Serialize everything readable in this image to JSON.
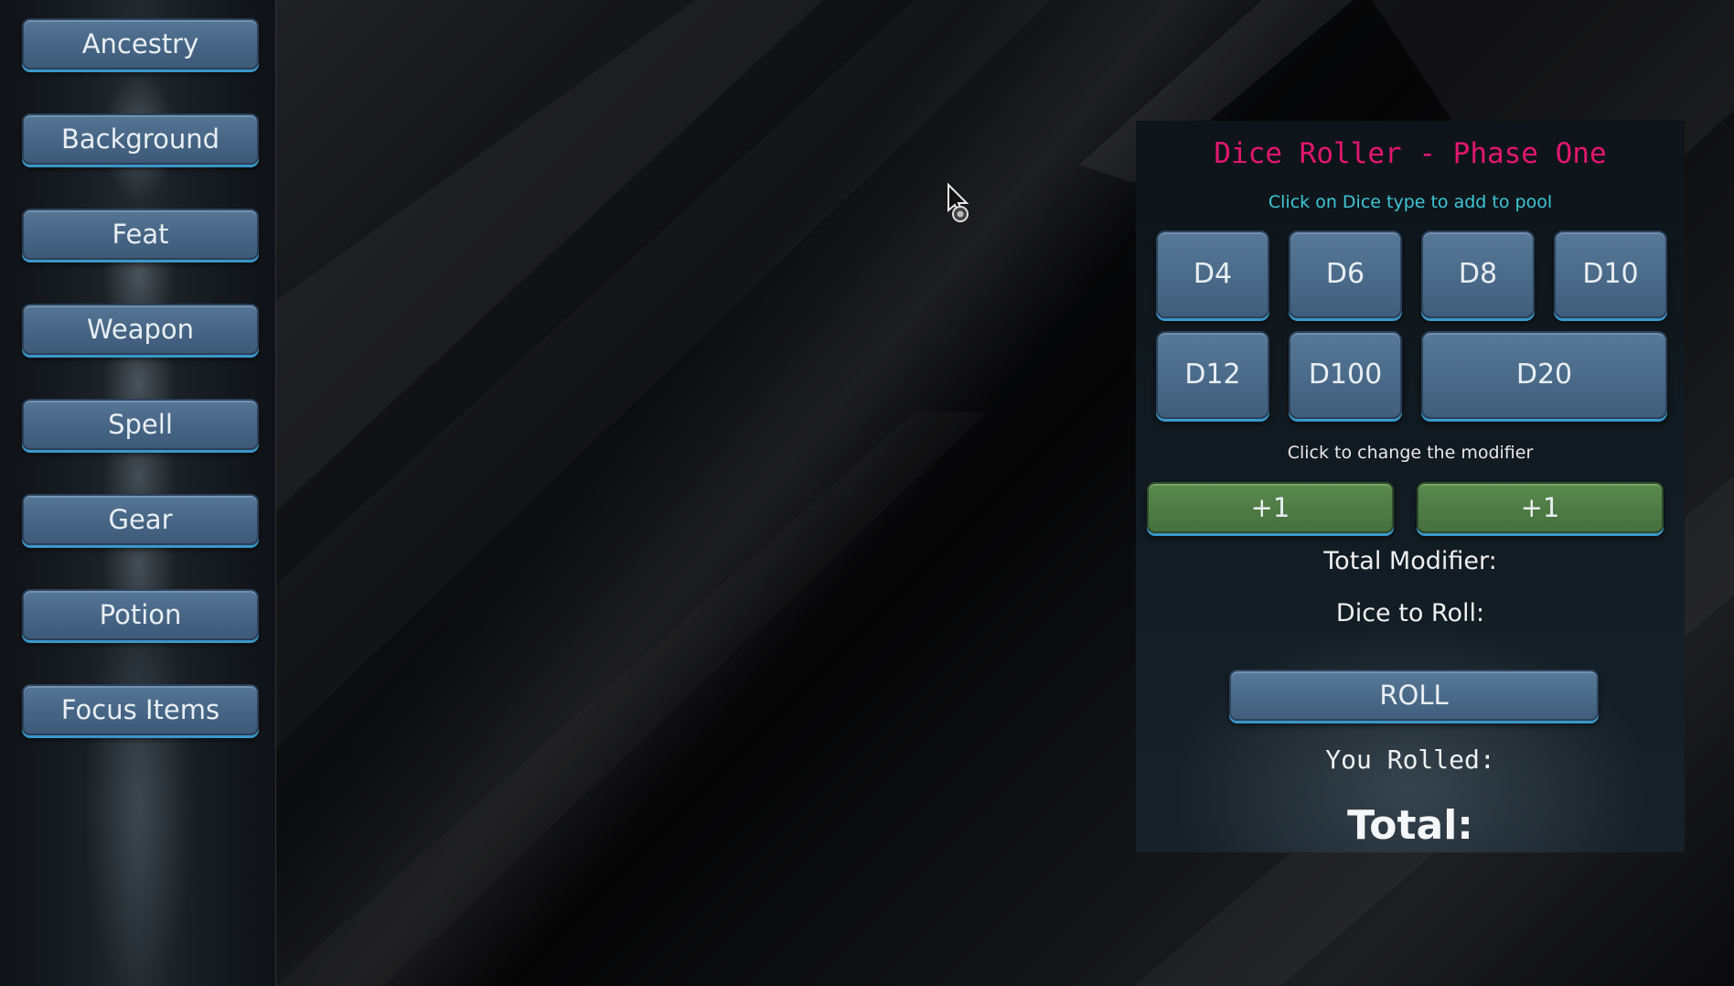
{
  "sidebar": {
    "items": [
      {
        "label": "Ancestry"
      },
      {
        "label": "Background"
      },
      {
        "label": "Feat"
      },
      {
        "label": "Weapon"
      },
      {
        "label": "Spell"
      },
      {
        "label": "Gear"
      },
      {
        "label": "Potion"
      },
      {
        "label": "Focus Items"
      }
    ]
  },
  "dice_roller": {
    "title": "Dice Roller - Phase One",
    "dice_hint": "Click on Dice type to add to pool",
    "dice": [
      {
        "label": "D4"
      },
      {
        "label": "D6"
      },
      {
        "label": "D8"
      },
      {
        "label": "D10"
      },
      {
        "label": "D12"
      },
      {
        "label": "D100"
      },
      {
        "label": "D20"
      }
    ],
    "modifier_hint": "Click to change the modifier",
    "modifiers": [
      {
        "label": "+1"
      },
      {
        "label": "+1"
      }
    ],
    "total_modifier_label": "Total Modifier:",
    "dice_to_roll_label": "Dice to Roll:",
    "roll_label": "ROLL",
    "you_rolled_label": "You Rolled:",
    "total_label": "Total:"
  },
  "colors": {
    "title_accent": "#e2176e",
    "hint_accent": "#3ec7d6",
    "button_blue": "#4a6a89",
    "button_green": "#4d7a44",
    "button_glow": "#3a97c9"
  },
  "icons": {
    "cursor": "busy-arrow-cursor-icon"
  }
}
